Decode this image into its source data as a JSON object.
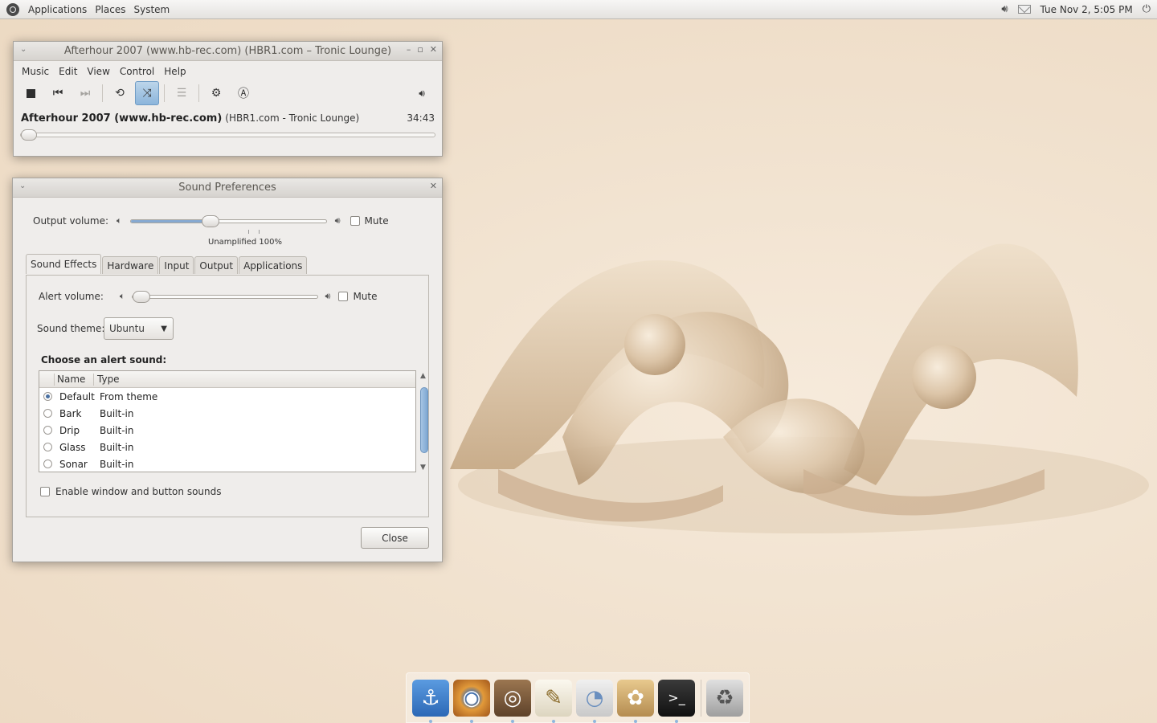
{
  "top_panel": {
    "menus": [
      "Applications",
      "Places",
      "System"
    ],
    "clock": "Tue Nov  2,  5:05 PM"
  },
  "rhythmbox": {
    "title": "Afterhour 2007 (www.hb-rec.com) (HBR1.com – Tronic Lounge)",
    "menus": [
      "Music",
      "Edit",
      "View",
      "Control",
      "Help"
    ],
    "now_playing": {
      "title": "Afterhour 2007 (www.hb-rec.com)",
      "artist": "(HBR1.com - Tronic Lounge)",
      "time": "34:43"
    },
    "shuffle_active": true,
    "progress": 0
  },
  "sound_prefs": {
    "title": "Sound Preferences",
    "output_volume_label": "Output volume:",
    "output_volume_percent": 41,
    "mute_label": "Mute",
    "output_mute": false,
    "scale_label": "Unamplified 100%",
    "tabs": [
      "Sound Effects",
      "Hardware",
      "Input",
      "Output",
      "Applications"
    ],
    "active_tab": "Sound Effects",
    "alert_volume_label": "Alert volume:",
    "alert_volume_percent": 0,
    "alert_mute": false,
    "sound_theme_label": "Sound theme:",
    "sound_theme_value": "Ubuntu",
    "choose_label": "Choose an alert sound:",
    "columns": [
      "Name",
      "Type"
    ],
    "alerts": [
      {
        "name": "Default",
        "type": "From theme",
        "selected": true
      },
      {
        "name": "Bark",
        "type": "Built-in",
        "selected": false
      },
      {
        "name": "Drip",
        "type": "Built-in",
        "selected": false
      },
      {
        "name": "Glass",
        "type": "Built-in",
        "selected": false
      },
      {
        "name": "Sonar",
        "type": "Built-in",
        "selected": false
      }
    ],
    "enable_sounds_label": "Enable window and button sounds",
    "close_label": "Close"
  },
  "dock": {
    "items": [
      "anchor-icon",
      "eye-icon",
      "speaker-icon",
      "text-editor-icon",
      "disk-icon",
      "paint-icon",
      "terminal-icon",
      "trash-icon"
    ],
    "colors": {
      "anchor": "#3d7fcf",
      "eye": "#d98a2c",
      "speaker": "#7a5a3c",
      "editor": "#efe9d8",
      "disk": "#d8d8d8",
      "paint": "#c9a36a",
      "terminal": "#222222",
      "trash": "#bdbdbd"
    }
  }
}
